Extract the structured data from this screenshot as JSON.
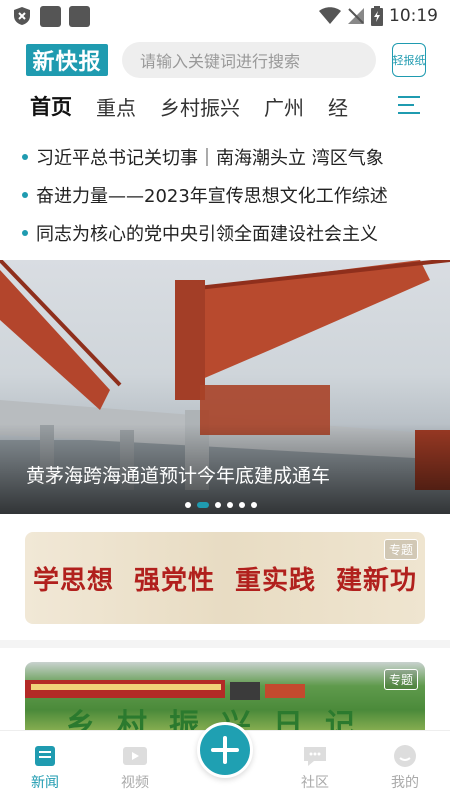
{
  "status_bar": {
    "time": "10:19"
  },
  "header": {
    "logo_text": "新快报",
    "search_placeholder": "请输入关键词进行搜索",
    "light_paper_label": "轻报纸"
  },
  "tabs": [
    {
      "label": "首页",
      "active": true
    },
    {
      "label": "重点"
    },
    {
      "label": "乡村振兴"
    },
    {
      "label": "广州"
    },
    {
      "label": "经"
    }
  ],
  "headlines": [
    "习近平总书记关切事｜南海潮头立 湾区气象",
    "奋进力量——2023年宣传思想文化工作综述",
    "同志为核心的党中央引领全面建设社会主义"
  ],
  "banner": {
    "caption": "黄茅海跨海通道预计今年底建成通车",
    "slide_count": 6,
    "active_slide": 2
  },
  "cards": [
    {
      "badge": "专题",
      "slogans": [
        "学思想",
        "强党性",
        "重实践",
        "建新功"
      ]
    },
    {
      "badge": "专题",
      "text": "乡村振兴日记"
    }
  ],
  "bottom_nav": [
    {
      "label": "新闻",
      "active": true
    },
    {
      "label": "视频"
    },
    {
      "label": "社区"
    },
    {
      "label": "我的"
    }
  ],
  "colors": {
    "accent": "#1f9bb0",
    "slogan_red": "#b1201d"
  }
}
